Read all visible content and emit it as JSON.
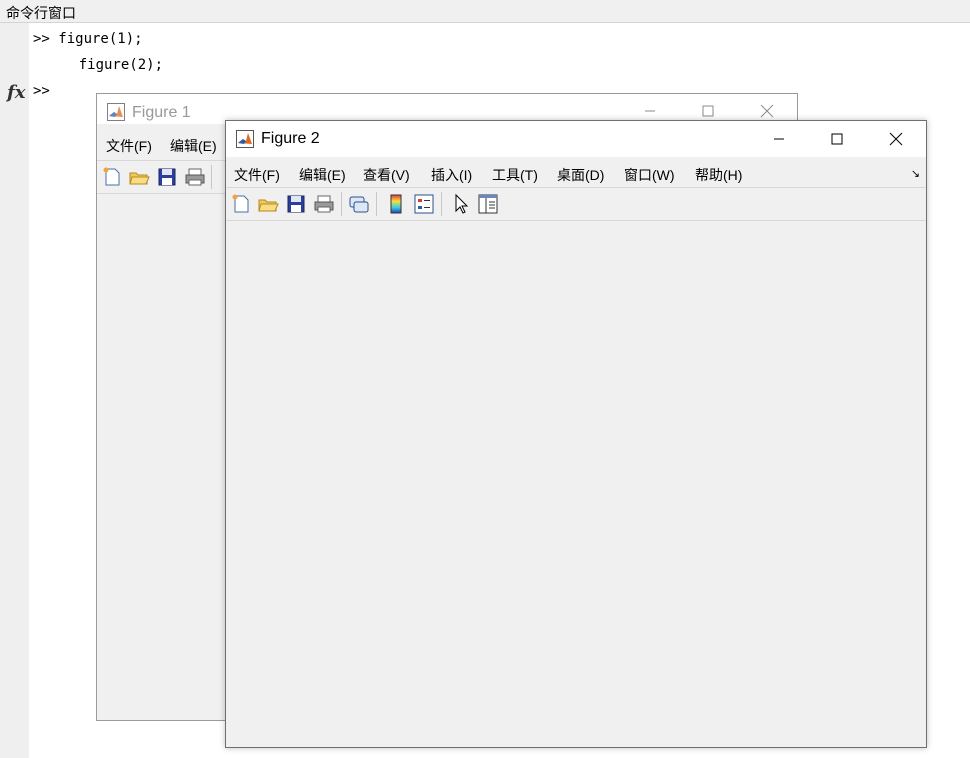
{
  "command_window": {
    "title": "命令行窗口",
    "lines": [
      ">> figure(1);",
      "    figure(2);"
    ],
    "prompt": ">>",
    "fx_label": "fx"
  },
  "figure1": {
    "title": "Figure 1",
    "menu": [
      "文件(F)",
      "编辑(E)"
    ]
  },
  "figure2": {
    "title": "Figure 2",
    "menu": [
      "文件(F)",
      "编辑(E)",
      "查看(V)",
      "插入(I)",
      "工具(T)",
      "桌面(D)",
      "窗口(W)",
      "帮助(H)"
    ],
    "dock_glyph": "↘"
  },
  "toolbar_icons": [
    "new-file-icon",
    "open-folder-icon",
    "save-icon",
    "print-icon",
    "link-icon",
    "colorbar-icon",
    "legend-icon",
    "pointer-icon",
    "property-inspector-icon"
  ],
  "colors": {
    "bg": "#f0f0f0",
    "titlebar": "#ffffff"
  }
}
